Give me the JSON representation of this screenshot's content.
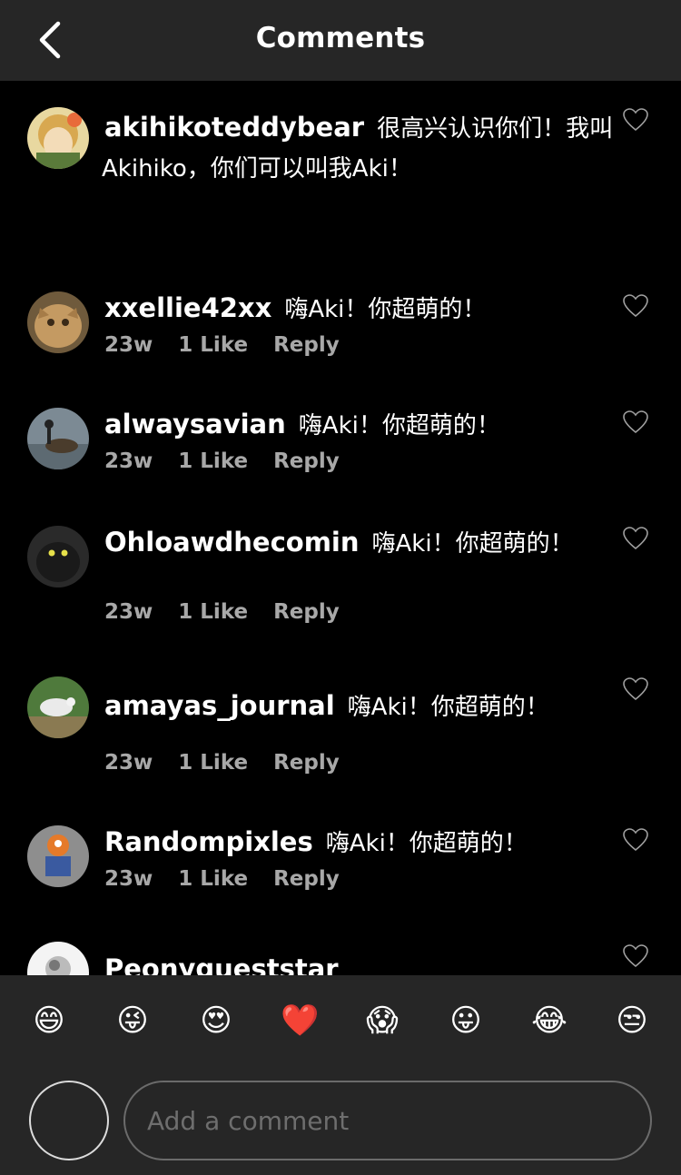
{
  "header": {
    "title": "Comments"
  },
  "comments": [
    {
      "username": "akihikoteddybear",
      "text": "很高兴认识你们！我叫",
      "text2": "Akihiko，你们可以叫我Aki！"
    },
    {
      "username": "xxellie42xx",
      "text": "嗨Aki！你超萌的！",
      "age": "23w",
      "likes": "1 Like",
      "reply": "Reply"
    },
    {
      "username": "alwaysavian",
      "text": "嗨Aki！你超萌的！",
      "age": "23w",
      "likes": "1 Like",
      "reply": "Reply"
    },
    {
      "username": "Ohloawdhecomin",
      "text": "嗨Aki！你超萌的！",
      "age": "23w",
      "likes": "1 Like",
      "reply": "Reply"
    },
    {
      "username": "amayas_journal",
      "text": "嗨Aki！你超萌的！",
      "age": "23w",
      "likes": "1 Like",
      "reply": "Reply"
    },
    {
      "username": "Randompixles",
      "text": "嗨Aki！你超萌的！",
      "age": "23w",
      "likes": "1 Like",
      "reply": "Reply"
    },
    {
      "username": "Peonygueststar"
    }
  ],
  "emojis": [
    "😄",
    "😜",
    "😍",
    "❤️",
    "😱",
    "😛",
    "😂",
    "😒"
  ],
  "composer": {
    "placeholder": "Add a comment"
  },
  "colors": {
    "header_bg": "#262626",
    "feed_bg": "#000000",
    "meta_text": "#a8a8a8"
  }
}
